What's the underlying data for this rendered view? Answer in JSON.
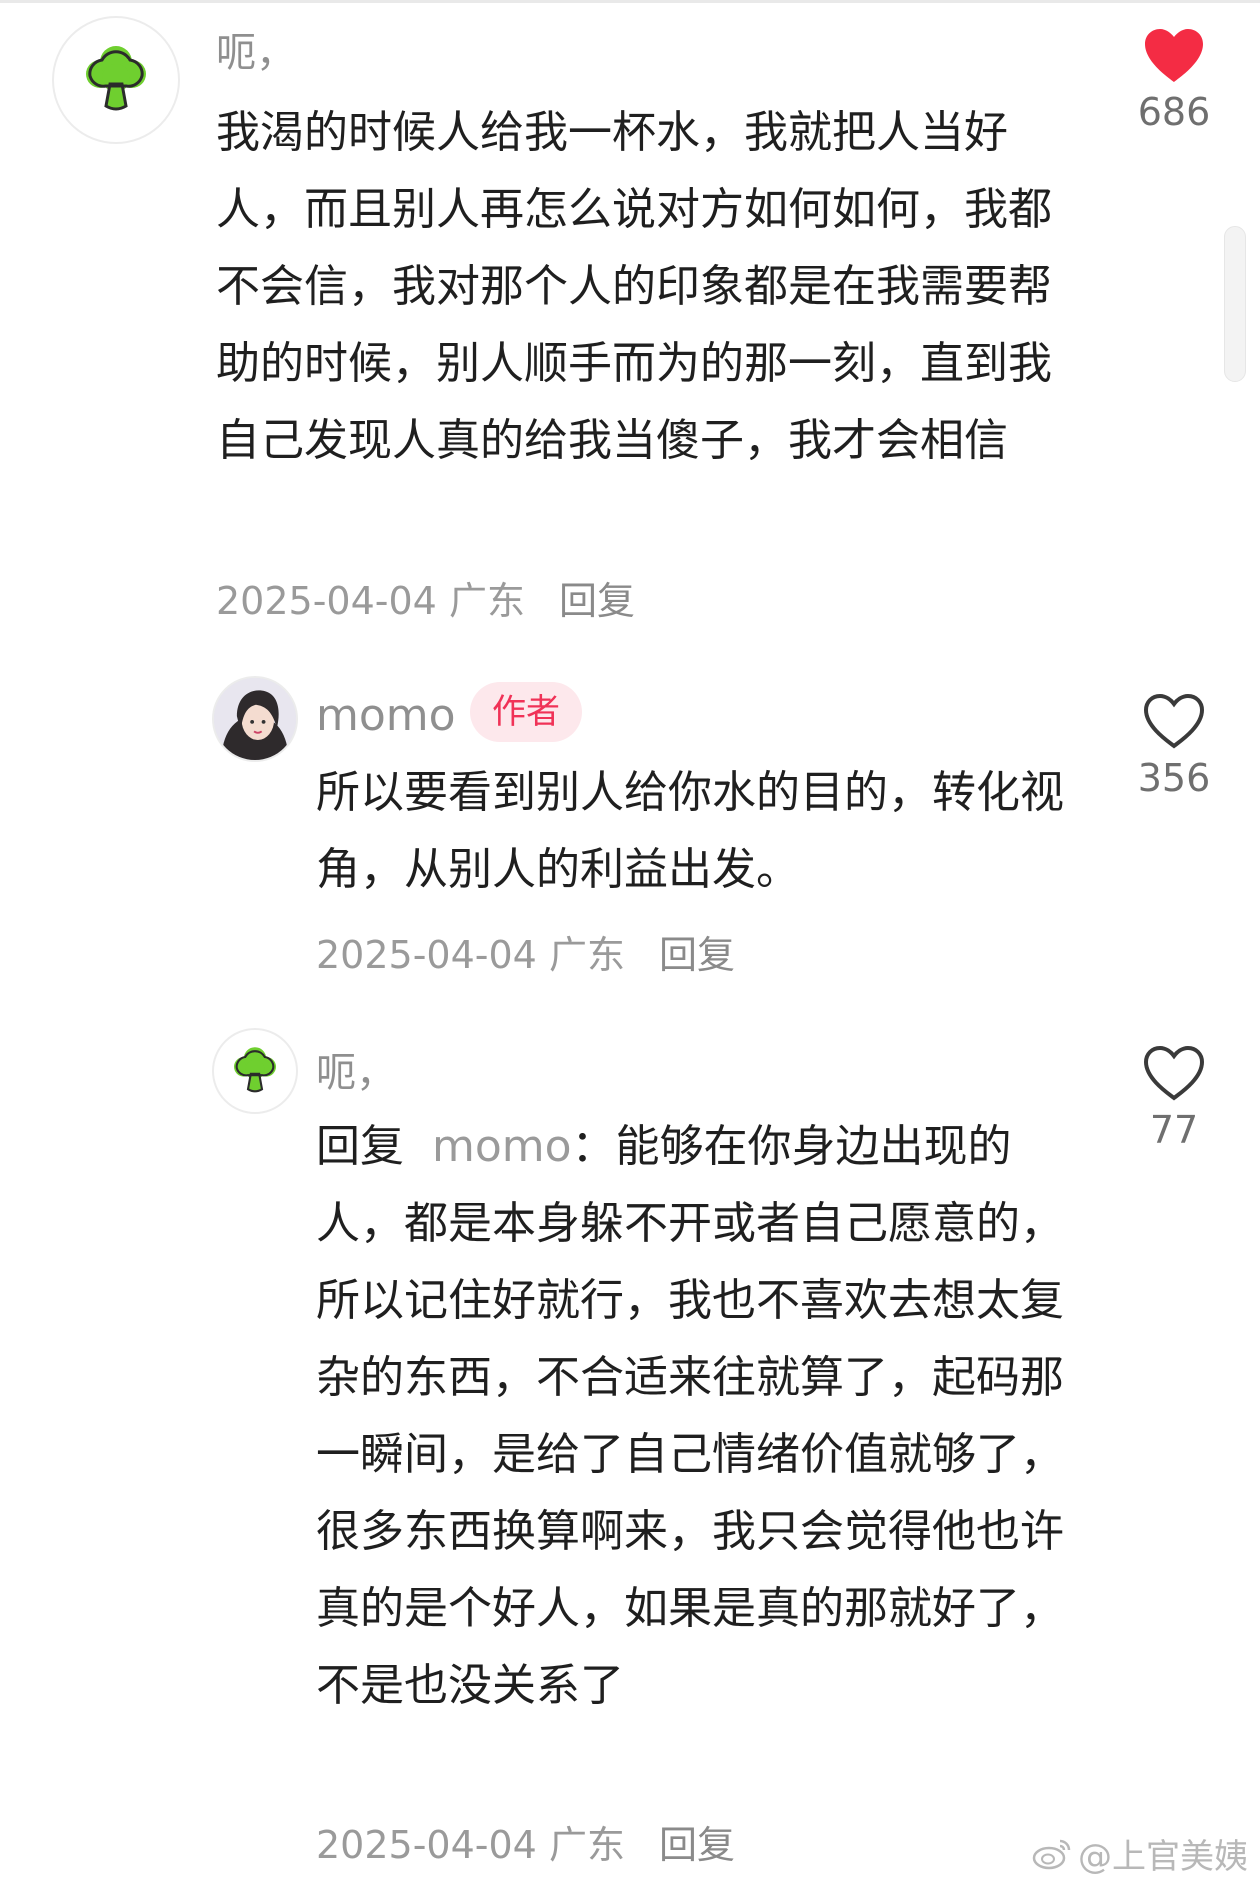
{
  "comments": [
    {
      "username": "呃，",
      "avatar_icon": "broccoli-icon",
      "text": "我渴的时候人给我一杯水，我就把人当好人，而且别人再怎么说对方如何如何，我都不会信，我对那个人的印象都是在我需要帮助的时候，别人顺手而为的那一刻，直到我自己发现人真的给我当傻子，我才会相信",
      "date": "2025-04-04",
      "location": "广东",
      "reply_label": "回复",
      "likes": "686",
      "liked": true
    },
    {
      "username": "momo",
      "badge": "作者",
      "avatar_icon": "user-photo-avatar",
      "text": "所以要看到别人给你水的目的，转化视角，从别人的利益出发。",
      "date": "2025-04-04",
      "location": "广东",
      "reply_label": "回复",
      "likes": "356",
      "liked": false
    },
    {
      "username": "呃，",
      "avatar_icon": "broccoli-icon",
      "reply_prefix": "回复",
      "reply_target": "momo",
      "reply_colon": "：",
      "text": "能够在你身边出现的人，都是本身躲不开或者自己愿意的，所以记住好就行，我也不喜欢去想太复杂的东西，不合适来往就算了，起码那一瞬间，是给了自己情绪价值就够了，很多东西换算啊来，我只会觉得他也许真的是个好人，如果是真的那就好了，不是也没关系了",
      "date": "2025-04-04",
      "location": "广东",
      "reply_label": "回复",
      "likes": "77",
      "liked": false
    }
  ],
  "watermark": "@上官美姨",
  "colors": {
    "heart_liked": "#f42c44",
    "author_badge_text": "#f03257",
    "author_badge_bg": "#fde8ec",
    "broccoli_green": "#6fcf2f"
  }
}
